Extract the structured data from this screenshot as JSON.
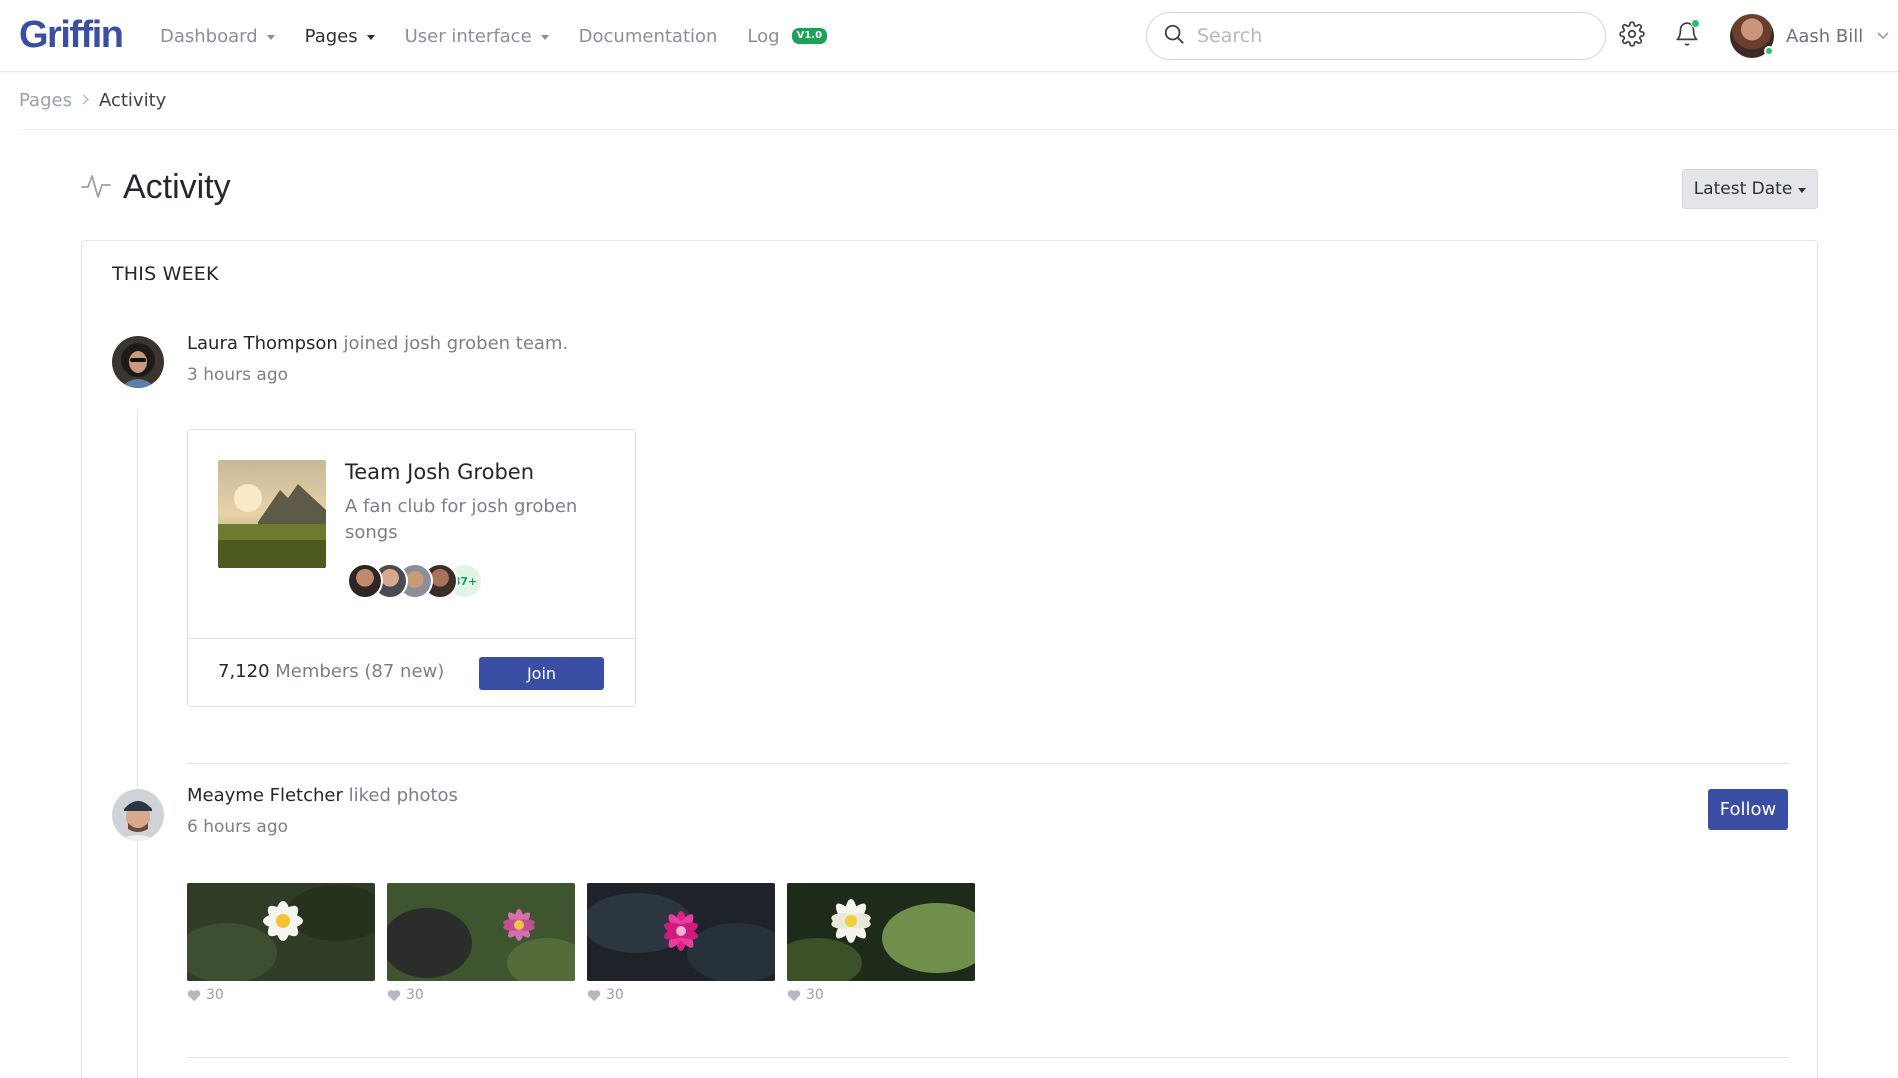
{
  "header": {
    "logo": "Griffin",
    "nav": [
      {
        "label": "Dashboard",
        "has_caret": true
      },
      {
        "label": "Pages",
        "has_caret": true,
        "active": true
      },
      {
        "label": "User interface",
        "has_caret": true
      },
      {
        "label": "Documentation",
        "has_caret": false
      },
      {
        "label": "Log",
        "badge": "V1.0"
      }
    ],
    "search_placeholder": "Search",
    "user_name": "Aash Bill",
    "icons": [
      "search-icon",
      "gear-icon",
      "bell-icon",
      "chevron-down-icon"
    ]
  },
  "breadcrumb": {
    "parent": "Pages",
    "current": "Activity"
  },
  "page": {
    "title": "Activity",
    "title_icon": "activity-pulse-icon",
    "sort_label": "Latest Date"
  },
  "feed": {
    "section_title": "THIS WEEK",
    "items": [
      {
        "name": "Laura Thompson",
        "action": "joined josh groben team.",
        "time": "3 hours ago",
        "team": {
          "name": "Team Josh Groben",
          "description": "A fan club for josh groben songs",
          "more_members": "87+",
          "members_count": "7,120",
          "members_suffix": "Members (87 new)",
          "join_label": "Join"
        }
      },
      {
        "name": "Meayme Fletcher",
        "action": "liked photos",
        "time": "6 hours ago",
        "follow_label": "Follow",
        "photos": [
          {
            "likes": "30"
          },
          {
            "likes": "30"
          },
          {
            "likes": "30"
          },
          {
            "likes": "30"
          }
        ]
      }
    ]
  },
  "colors": {
    "brand": "#3a4fa4",
    "success": "#19a356",
    "muted": "#7a7f89"
  }
}
